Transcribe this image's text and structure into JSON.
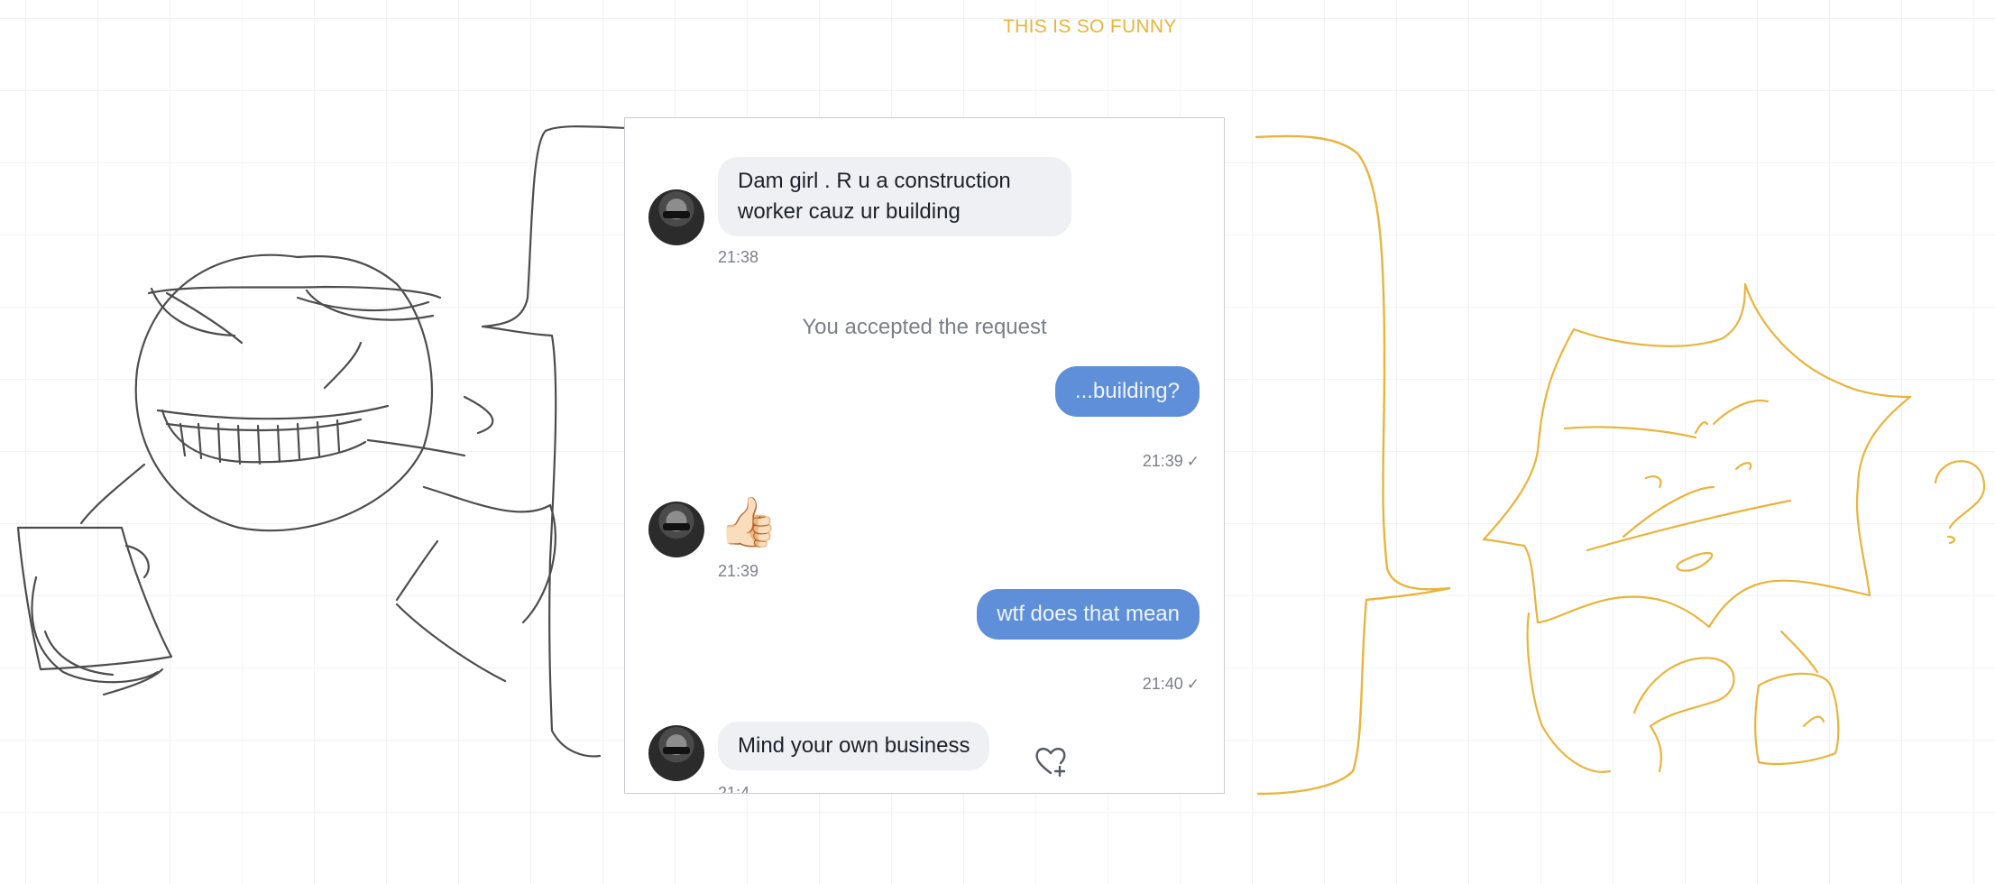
{
  "board": {
    "note": "THIS IS SO FUNNY",
    "ink_color": "#eab43b"
  },
  "chat": {
    "messages": [
      {
        "direction": "incoming",
        "text": "Dam girl . R u a construction worker cauz ur building",
        "time": "21:38",
        "icon": "avatar"
      },
      {
        "direction": "system",
        "text": "You accepted the request"
      },
      {
        "direction": "outgoing",
        "text": "...building?",
        "time": "21:39",
        "status": "✓"
      },
      {
        "direction": "incoming",
        "text": "👍🏻",
        "time": "21:39",
        "icon": "avatar"
      },
      {
        "direction": "outgoing",
        "text": "wtf does that mean",
        "time": "21:40",
        "status": "✓"
      },
      {
        "direction": "incoming",
        "text": "Mind your own business",
        "time": "21:4",
        "icon": "avatar",
        "extra_icon": "heart-plus-icon"
      }
    ],
    "colors": {
      "incoming_bubble": "#eef0f3",
      "outgoing_bubble": "#5f8fd9",
      "meta_text": "#7b7f86"
    }
  }
}
